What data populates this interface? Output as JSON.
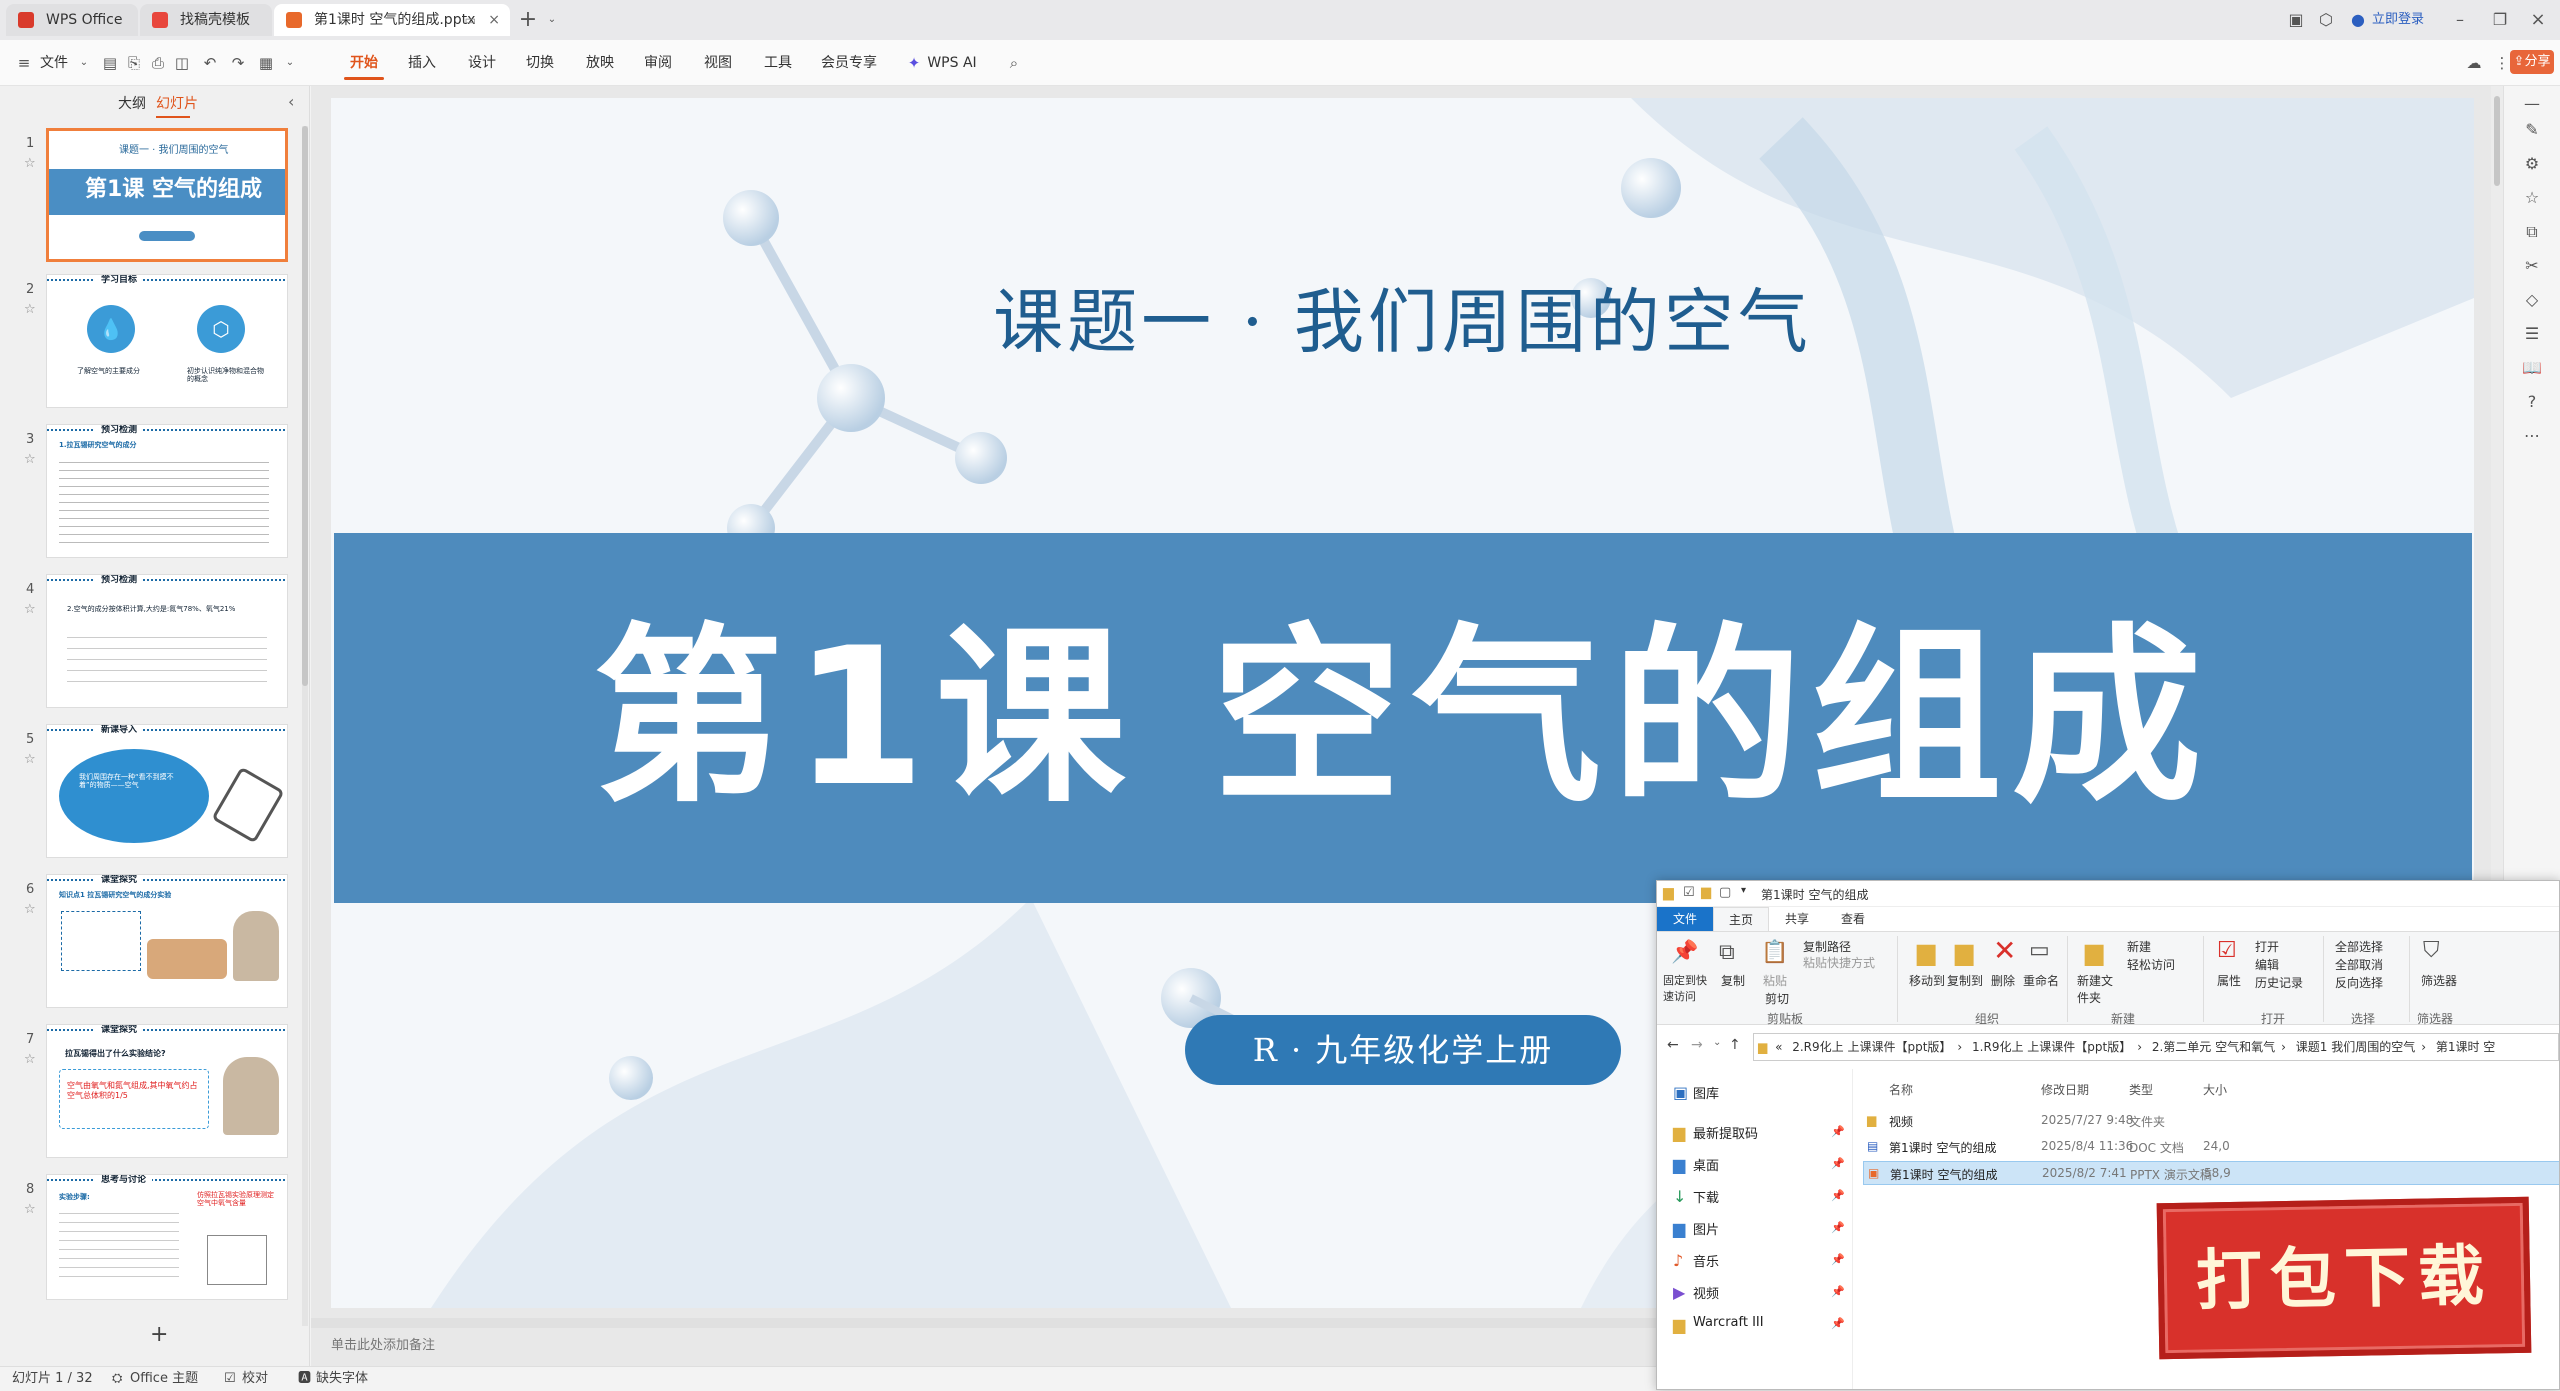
{
  "tabs": [
    {
      "label": "WPS Office"
    },
    {
      "label": "找稿壳模板"
    },
    {
      "label": "第1课时 空气的组成.pptx"
    }
  ],
  "titlebar": {
    "login": "立即登录"
  },
  "menu": {
    "file": "文件",
    "items": [
      "开始",
      "插入",
      "设计",
      "切换",
      "放映",
      "审阅",
      "视图",
      "工具",
      "会员专享",
      "WPS AI"
    ],
    "share": "分享"
  },
  "panel": {
    "tabs": [
      "大纲",
      "幻灯片"
    ],
    "add": "+"
  },
  "thumbs": [
    {
      "n": "1",
      "head": "课题一 · 我们周围的空气",
      "title": "第1课 空气的组成"
    },
    {
      "n": "2",
      "head": "学习目标",
      "a": "了解空气的主要成分",
      "b": "初步认识纯净物和混合物的概念"
    },
    {
      "n": "3",
      "head": "预习检测",
      "sub": "1.拉瓦锡研究空气的成分"
    },
    {
      "n": "4",
      "head": "预习检测",
      "sub": "2.空气的成分按体积计算,大约是:氮气78%、氧气21%"
    },
    {
      "n": "5",
      "head": "新课导入",
      "sub": "我们周围存在一种“看不到摸不着”的物质——空气"
    },
    {
      "n": "6",
      "head": "课堂探究",
      "sub": "知识点1 拉瓦锡研究空气的成分实验"
    },
    {
      "n": "7",
      "head": "课堂探究",
      "sub": "拉瓦锡得出了什么实验结论?",
      "red": "空气由氧气和氮气组成,其中氧气约占空气总体积的1/5"
    },
    {
      "n": "8",
      "head": "思考与讨论",
      "sub": "实验步骤:",
      "red": "仿照拉瓦锡实验原理测定空气中氧气含量"
    }
  ],
  "slide": {
    "top": "课题一 · 我们周围的空气",
    "main": "第1课 空气的组成",
    "pill": "R · 九年级化学上册",
    "notes": "单击此处添加备注"
  },
  "status": {
    "slide": "幻灯片 1 / 32",
    "theme": "Office 主题",
    "check": "校对",
    "font": "缺失字体"
  },
  "explorer": {
    "title": "第1课时 空气的组成",
    "tabs": [
      "文件",
      "主页",
      "共享",
      "查看"
    ],
    "ribbon": {
      "pin": "固定到快速访问",
      "copy": "复制",
      "paste": "粘贴",
      "copypath": "复制路径",
      "pasteshort": "粘贴快捷方式",
      "cut": "剪切",
      "clip": "剪贴板",
      "move": "移动到",
      "copyto": "复制到",
      "delete": "删除",
      "rename": "重命名",
      "org": "组织",
      "newfolder": "新建文件夹",
      "newitem": "新建",
      "easy": "轻松访问",
      "new": "新建",
      "prop": "属性",
      "open": "打开",
      "edit": "编辑",
      "history": "历史记录",
      "openg": "打开",
      "selall": "全部选择",
      "selnone": "全部取消",
      "selinv": "反向选择",
      "sel": "选择",
      "filter": "筛选器",
      "filterg": "筛选器"
    },
    "path": [
      "«",
      "2.R9化上 上课课件【ppt版】",
      "1.R9化上 上课课件【ppt版】",
      "2.第二单元 空气和氧气",
      "课题1 我们周围的空气",
      "第1课时 空"
    ],
    "side": [
      "图库",
      "最新提取码",
      "桌面",
      "下载",
      "图片",
      "音乐",
      "视频",
      "Warcraft III"
    ],
    "cols": [
      "名称",
      "修改日期",
      "类型",
      "大小"
    ],
    "rows": [
      {
        "name": "视频",
        "date": "2025/7/27 9:48",
        "type": "文件夹",
        "size": ""
      },
      {
        "name": "第1课时 空气的组成",
        "date": "2025/8/4 11:36",
        "type": "DOC 文档",
        "size": "24,0"
      },
      {
        "name": "第1课时 空气的组成",
        "date": "2025/8/2 7:41",
        "type": "PPTX 演示文稿",
        "size": "58,9"
      }
    ]
  },
  "stamp": "打包下载"
}
